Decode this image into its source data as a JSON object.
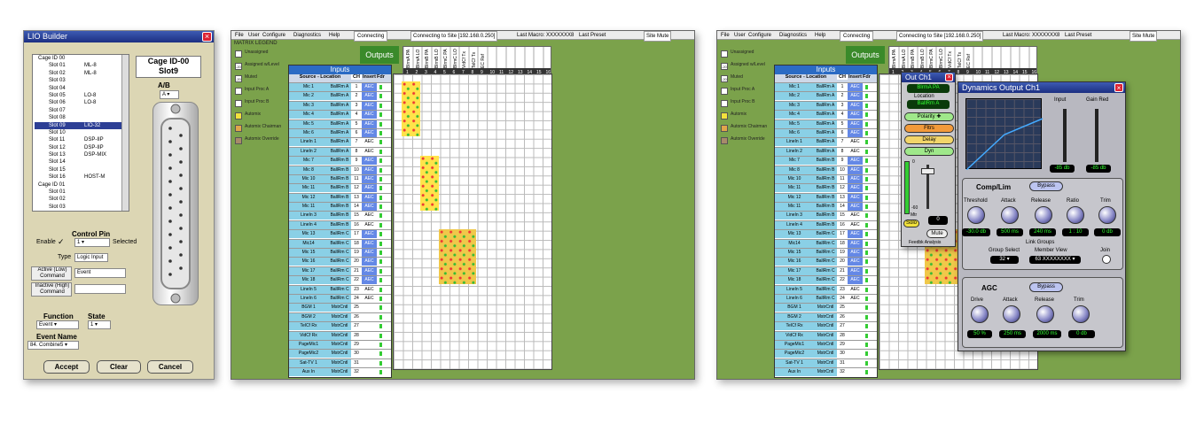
{
  "lio": {
    "title": "LIO Builder",
    "tree": [
      {
        "t": "Cage ID 00",
        "n": "",
        "lvl": 0
      },
      {
        "t": "Slot 01",
        "n": "ML-8",
        "lvl": 1
      },
      {
        "t": "Slot 02",
        "n": "ML-8",
        "lvl": 1
      },
      {
        "t": "Slot 03",
        "n": "",
        "lvl": 1
      },
      {
        "t": "Slot 04",
        "n": "",
        "lvl": 1
      },
      {
        "t": "Slot 05",
        "n": "LO-8",
        "lvl": 1
      },
      {
        "t": "Slot 06",
        "n": "LO-8",
        "lvl": 1
      },
      {
        "t": "Slot 07",
        "n": "",
        "lvl": 1
      },
      {
        "t": "Slot 08",
        "n": "",
        "lvl": 1
      },
      {
        "t": "Slot 09",
        "n": "LIO-32",
        "lvl": 1,
        "sel": true
      },
      {
        "t": "Slot 10",
        "n": "",
        "lvl": 1
      },
      {
        "t": "Slot 11",
        "n": "DSP-IIP",
        "lvl": 1
      },
      {
        "t": "Slot 12",
        "n": "DSP-IIP",
        "lvl": 1
      },
      {
        "t": "Slot 13",
        "n": "DSP-MIX",
        "lvl": 1
      },
      {
        "t": "Slot 14",
        "n": "",
        "lvl": 1
      },
      {
        "t": "Slot 15",
        "n": "",
        "lvl": 1
      },
      {
        "t": "Slot 16",
        "n": "HOST-M",
        "lvl": 1
      },
      {
        "t": "Cage ID 01",
        "n": "",
        "lvl": 0
      },
      {
        "t": "Slot 01",
        "n": "",
        "lvl": 1
      },
      {
        "t": "Slot 02",
        "n": "",
        "lvl": 1
      },
      {
        "t": "Slot 03",
        "n": "",
        "lvl": 1
      }
    ],
    "cage": "Cage ID-00",
    "slot": "Slot9",
    "ab_label": "A/B",
    "ab_value": "A",
    "control_pin": "Control Pin",
    "enable": "Enable",
    "check": "✓",
    "pin_value": "1",
    "selected": "Selected",
    "type_label": "Type",
    "type_value": "Logic Input",
    "active_label": "Active (Low) Command",
    "active_value": "Event",
    "inactive_label": "Inactive (High) Command",
    "inactive_value": "",
    "function_label": "Function",
    "function_value": "Event",
    "state_label": "State",
    "state_value": "1",
    "event_name_label": "Event Name",
    "event_name_value": "84.  Combine5",
    "accept": "Accept",
    "clear": "Clear",
    "cancel": "Cancel"
  },
  "matrix": {
    "menu": [
      "File",
      "User",
      "Configure",
      "Diagnostics",
      "Help"
    ],
    "connecting": "Connecting",
    "site": "Connecting to Site [192.168.0.250]",
    "last_macro": "Last Macro: XXXXXXX8",
    "last_preset": "Last Preset",
    "site_mute": "Site Mute",
    "legend_title": "MATRIX LEGEND",
    "legend": [
      {
        "t": "Unassigned",
        "c": "#ffffff"
      },
      {
        "t": "Assigned w/Level",
        "c": "#ffffff",
        "v": "-20"
      },
      {
        "t": "Muted",
        "c": "#ffffff",
        "v": "-20"
      },
      {
        "t": "Input Proc A",
        "c": "#ffffff"
      },
      {
        "t": "Input Proc B",
        "c": "#ffffff"
      },
      {
        "t": "Automix",
        "c": "#f2e23c"
      },
      {
        "t": "Automix Chairman",
        "c": "#e0a64b"
      },
      {
        "t": "Automix Override",
        "c": "#a88a6a"
      }
    ],
    "outputs": "Outputs",
    "inputs": "Inputs",
    "hdr": {
      "src": "Source - Location",
      "ch": "CH",
      "ins": "Insert",
      "fdr": "Fdr"
    },
    "out_cols": [
      "BlrmA PA",
      "BlrmA LO",
      "BlrmB PA",
      "BlrmB LO",
      "BlrmC PA",
      "BlrmC LO",
      "VidCf Tx",
      "TelCf Tx",
      "EC Ref",
      "",
      "",
      "",
      "",
      "",
      "",
      ""
    ],
    "fdr_label": "Fdr",
    "mix_label": "Mix",
    "rows": [
      [
        "Mic 1",
        "BallRm A",
        "1",
        "AEC"
      ],
      [
        "Mic 2",
        "BallRm A",
        "2",
        "AEC"
      ],
      [
        "Mic 3",
        "BallRm A",
        "3",
        "AEC"
      ],
      [
        "Mic 4",
        "BallRm A",
        "4",
        "AEC"
      ],
      [
        "Mic 5",
        "BallRm A",
        "5",
        "AEC"
      ],
      [
        "Mic 6",
        "BallRm A",
        "6",
        "AEC"
      ],
      [
        "LineIn 1",
        "BallRm A",
        "7",
        "AEC"
      ],
      [
        "LineIn 2",
        "BallRm A",
        "8",
        "AEC"
      ],
      [
        "Mic 7",
        "BallRm B",
        "9",
        "AEC"
      ],
      [
        "Mic 8",
        "BallRm B",
        "10",
        "AEC"
      ],
      [
        "Mic 10",
        "BallRm B",
        "11",
        "AEC"
      ],
      [
        "Mic 11",
        "BallRm B",
        "12",
        "AEC"
      ],
      [
        "Mic 12",
        "BallRm B",
        "13",
        "AEC"
      ],
      [
        "Mic 11",
        "BallRm B",
        "14",
        "AEC"
      ],
      [
        "LineIn 3",
        "BallRm B",
        "15",
        "AEC"
      ],
      [
        "LineIn 4",
        "BallRm B",
        "16",
        "AEC"
      ],
      [
        "Mic 13",
        "BallRm C",
        "17",
        "AEC"
      ],
      [
        "Mic14",
        "BallRm C",
        "18",
        "AEC"
      ],
      [
        "Mic 15",
        "BallRm C",
        "19",
        "AEC"
      ],
      [
        "Mic 16",
        "BallRm C",
        "20",
        "AEC"
      ],
      [
        "Mic 17",
        "BallRm C",
        "21",
        "AEC"
      ],
      [
        "Mic 18",
        "BallRm C",
        "22",
        "AEC"
      ],
      [
        "LineIn 5",
        "BallRm C",
        "23",
        "AEC"
      ],
      [
        "LineIn 6",
        "BallRm C",
        "24",
        "AEC"
      ],
      [
        "BGM 1",
        "MstrCntl",
        "25",
        ""
      ],
      [
        "BGM 2",
        "MstrCntl",
        "26",
        ""
      ],
      [
        "TelCf Rx",
        "MstrCntl",
        "27",
        ""
      ],
      [
        "VidCf Rx",
        "MstrCntl",
        "28",
        ""
      ],
      [
        "PageMic1",
        "MstrCntl",
        "29",
        ""
      ],
      [
        "PageMic2",
        "MstrCntl",
        "30",
        ""
      ],
      [
        "Sat-TV 1",
        "MstrCntl",
        "31",
        ""
      ],
      [
        "Aux In",
        "MstrCntl",
        "32",
        ""
      ]
    ]
  },
  "out_ch": {
    "title": "Out Ch1",
    "name": "BlrmA PA",
    "location_label": "Location",
    "location": "BallRm A",
    "polarity": "Polarity",
    "filters": "Fltrs",
    "delay": "Delay",
    "dyn": "Dyn",
    "solo": "Solo",
    "mute": "Mute",
    "mtr": "Mtr",
    "scale_0": "0",
    "scale_60": "-60",
    "fader_value": "0",
    "feedbk": "Feedbk Analysis"
  },
  "dyn": {
    "title": "Dynamics Output Ch1",
    "input": "Input",
    "gain_red": "Gain Red",
    "input_val": "-85 db",
    "gain_val": "-85 db",
    "comp_lim": "Comp/Lim",
    "bypass": "Bypass",
    "threshold": "Threshold",
    "attack": "Attack",
    "release": "Release",
    "ratio": "Ratio",
    "trim": "Trim",
    "threshold_val": "-30.0 db",
    "attack_val": "500 ms",
    "release_val": "240 ms",
    "ratio_val": "1 : 10",
    "trim_val": "0 db",
    "link_groups": "Link Groups",
    "group_select": "Group Select",
    "member_view": "Member View",
    "join": "Join",
    "group_val": "32",
    "member_val": "63  XXXXXXXX",
    "agc": "AGC",
    "drive": "Drive",
    "drive_val": "50 %",
    "agc_attack_val": "250 ms",
    "agc_release_val": "2000 ms",
    "agc_trim_val": "0 db"
  }
}
